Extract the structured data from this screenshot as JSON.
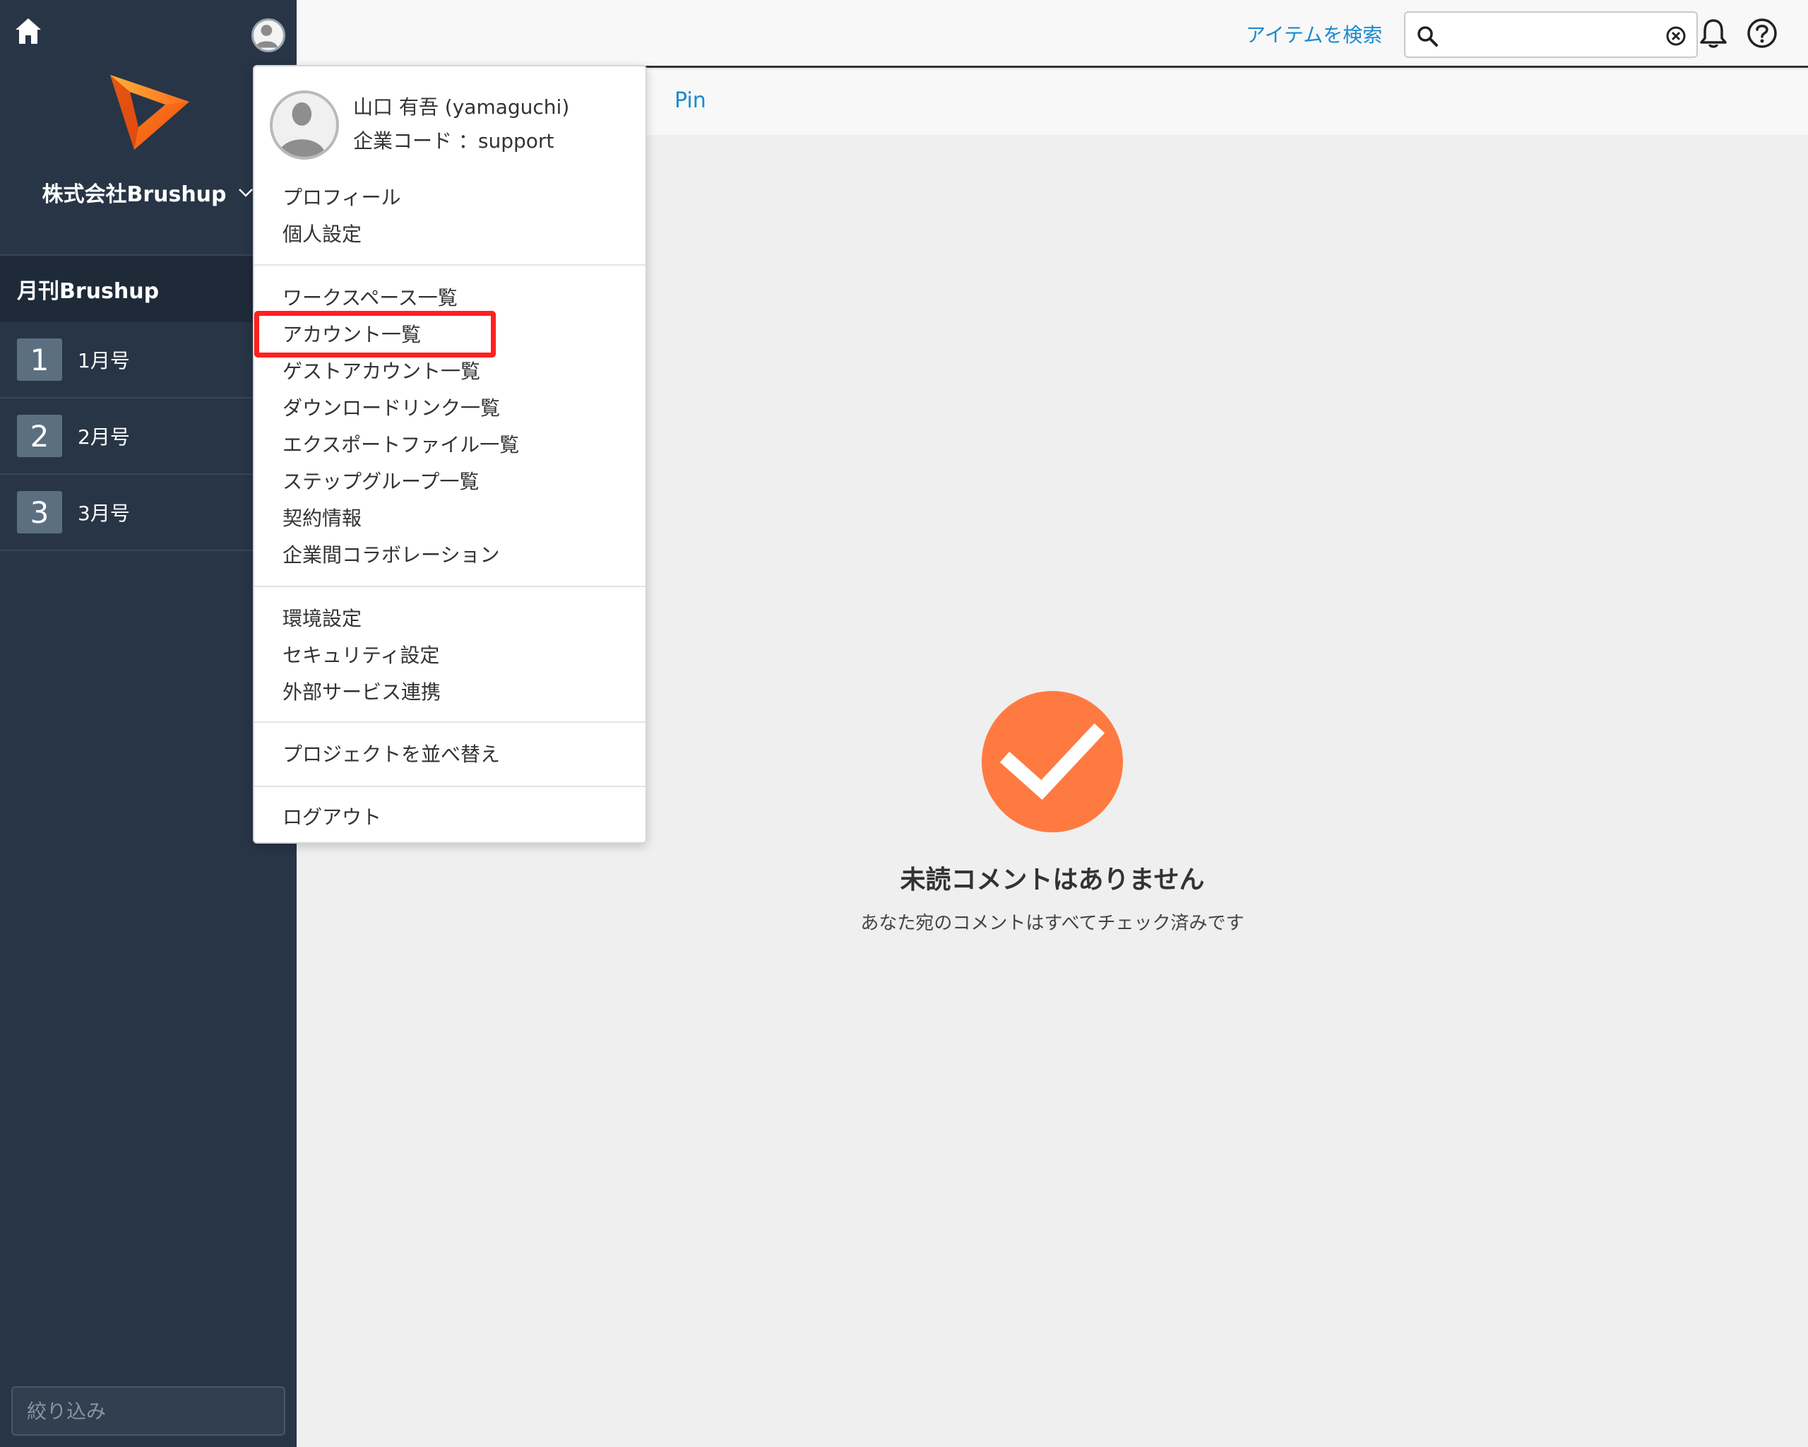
{
  "sidebar": {
    "company_name": "株式会社Brushup",
    "project_name": "月刊Brushup",
    "issues": [
      {
        "num": "1",
        "label": "1月号"
      },
      {
        "num": "2",
        "label": "2月号"
      },
      {
        "num": "3",
        "label": "3月号"
      }
    ],
    "filter_placeholder": "絞り込み"
  },
  "topbar": {
    "search_link": "アイテムを検索",
    "search_value": ""
  },
  "tabs": {
    "pin": "Pin"
  },
  "empty_state": {
    "title": "未読コメントはありません",
    "subtitle": "あなた宛のコメントはすべてチェック済みです"
  },
  "user_menu": {
    "username": "山口 有吾 (yamaguchi)",
    "company_code": "企業コード ：support",
    "section1": [
      "プロフィール",
      "個人設定"
    ],
    "section2": [
      "ワークスペース一覧",
      "アカウント一覧",
      "ゲストアカウント一覧",
      "ダウンロードリンク一覧",
      "エクスポートファイル一覧",
      "ステップグループ一覧",
      "契約情報",
      "企業間コラボレーション"
    ],
    "section3": [
      "環境設定",
      "セキュリティ設定",
      "外部サービス連携"
    ],
    "section4": [
      "プロジェクトを並べ替え"
    ],
    "section5": [
      "ログアウト"
    ]
  },
  "colors": {
    "sidebar_bg": "#283546",
    "accent_blue": "#1a8ad0",
    "check_orange": "#ff7a41",
    "highlight_red": "#ff2020"
  }
}
